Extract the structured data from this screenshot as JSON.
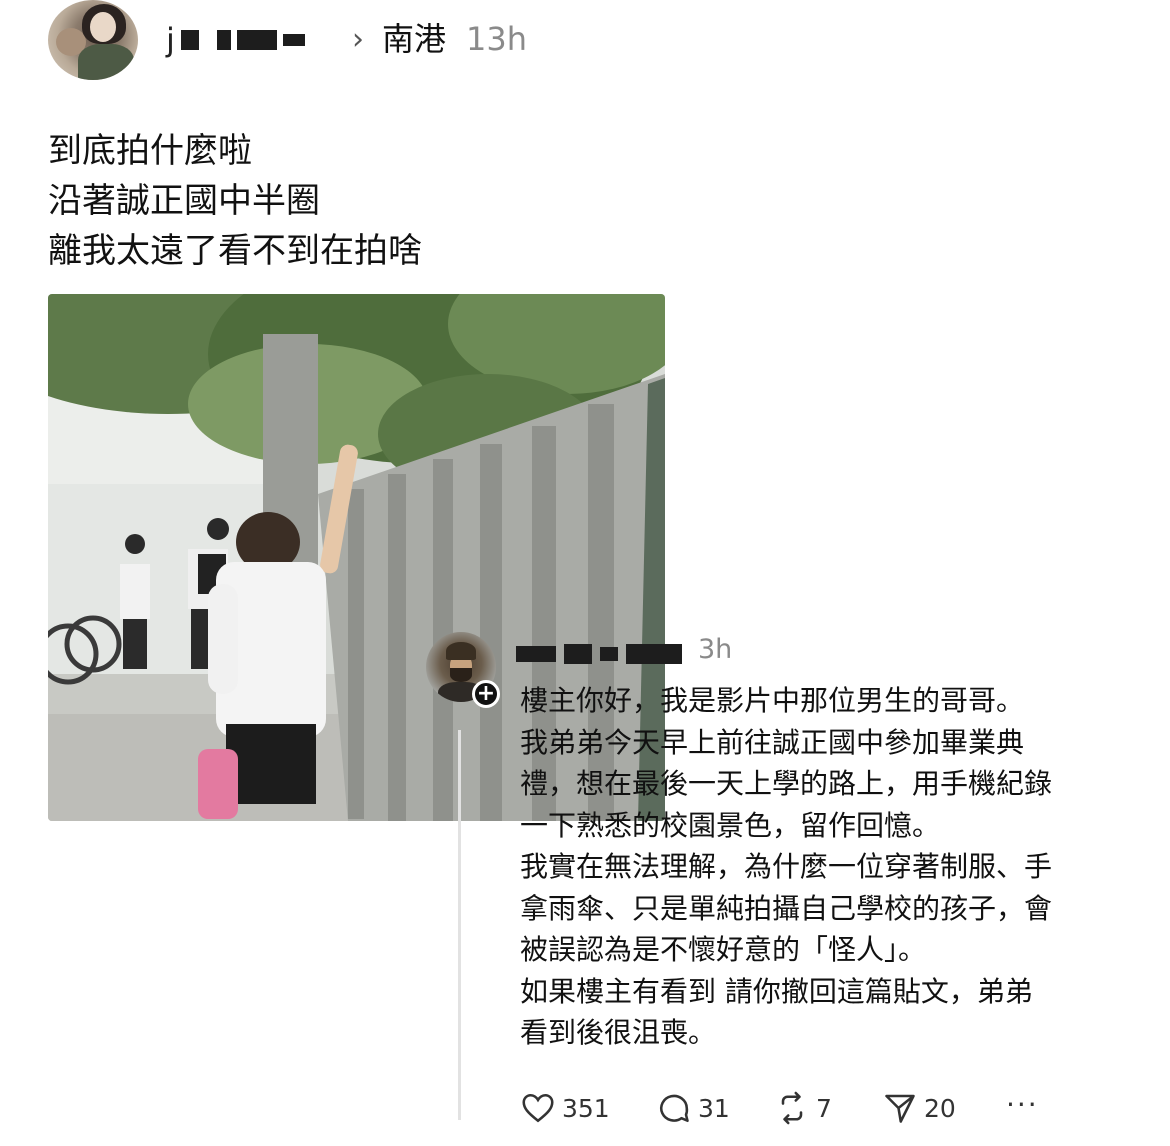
{
  "post": {
    "author_name_visible": "j",
    "location": "南港",
    "time": "13h",
    "lines": [
      "到底拍什麼啦",
      "沿著誠正國中半圈",
      "離我太遠了看不到在拍啥"
    ]
  },
  "reply": {
    "time": "3h",
    "text": "樓主你好，我是影片中那位男生的哥哥。\n我弟弟今天早上前往誠正國中參加畢業典\n禮，想在最後一天上學的路上，用手機紀錄\n一下熟悉的校園景色，留作回憶。\n我實在無法理解，為什麼一位穿著制服、手\n拿雨傘、只是單純拍攝自己學校的孩子，會\n被誤認為是不懷好意的「怪人」。\n如果樓主有看到 請你撤回這篇貼文，弟弟\n看到後很沮喪。",
    "follow_badge": "+"
  },
  "actions": {
    "likes": "351",
    "comments": "31",
    "reposts": "7",
    "shares": "20",
    "more": "···"
  },
  "icons": {
    "like": "heart-icon",
    "comment": "comment-bubble-icon",
    "repost": "repost-icon",
    "share": "send-icon",
    "chevron": "chevron-right-icon"
  }
}
